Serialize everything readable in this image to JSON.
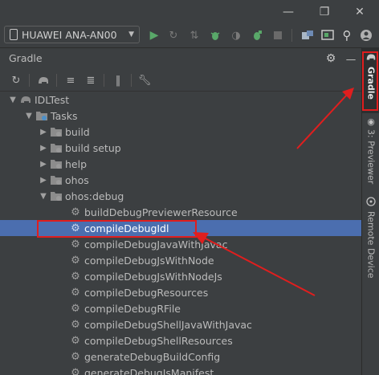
{
  "toolbar": {
    "device_label": "HUAWEI ANA-AN00"
  },
  "panel": {
    "title": "Gradle"
  },
  "tree": {
    "root": "IDLTest",
    "tasks": "Tasks",
    "groups": [
      "build",
      "build setup",
      "help",
      "ohos",
      "ohos:debug"
    ],
    "debug_tasks": [
      "buildDebugPreviewerResource",
      "compileDebugIdl",
      "compileDebugJavaWithJavac",
      "compileDebugJsWithNode",
      "compileDebugJsWithNodeJs",
      "compileDebugResources",
      "compileDebugRFile",
      "compileDebugShellJavaWithJavac",
      "compileDebugShellResources",
      "generateDebugBuildConfig",
      "generateDebugJsManifest"
    ],
    "selected_task": "compileDebugIdl"
  },
  "side_tabs": {
    "gradle": "Gradle",
    "previewer": "3: Previewer",
    "remote_device": "Remote Device"
  },
  "colors": {
    "background": "#3c3f41",
    "selection": "#4b6eaf",
    "annotation": "#e01e1e",
    "run_green": "#59a869"
  }
}
